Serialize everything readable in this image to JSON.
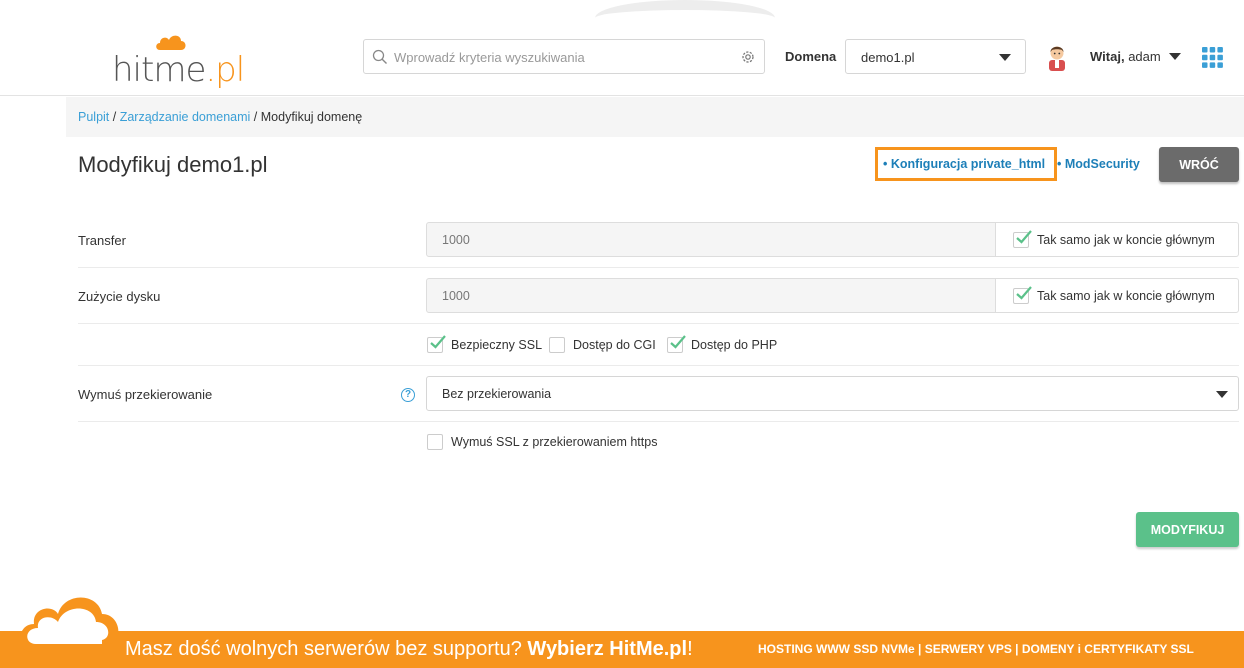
{
  "header": {
    "logo_text": "hitme",
    "logo_suffix": ".pl",
    "search_placeholder": "Wprowadź kryteria wyszukiwania",
    "domain_label": "Domena",
    "domain_value": "demo1.pl",
    "greeting_bold": "Witaj,",
    "greeting_user": "adam"
  },
  "breadcrumb": {
    "items": [
      "Pulpit",
      "Zarządzanie domenami"
    ],
    "separator": " / ",
    "current": "Modyfikuj domenę"
  },
  "page": {
    "title": "Modyfikuj demo1.pl",
    "link_private_html": "Konfiguracja private_html",
    "link_modsecurity": "ModSecurity",
    "back_label": "WRÓĆ",
    "bullet": "•"
  },
  "form": {
    "transfer": {
      "label": "Transfer",
      "value": "1000",
      "inherit_label": "Tak samo jak w koncie głównym",
      "inherit_checked": true
    },
    "disk": {
      "label": "Zużycie dysku",
      "value": "1000",
      "inherit_label": "Tak samo jak w koncie głównym",
      "inherit_checked": true
    },
    "options": [
      {
        "label": "Bezpieczny SSL",
        "checked": true
      },
      {
        "label": "Dostęp do CGI",
        "checked": false
      },
      {
        "label": "Dostęp do PHP",
        "checked": true
      }
    ],
    "redirect": {
      "label": "Wymuś przekierowanie",
      "value": "Bez przekierowania",
      "help": "?"
    },
    "force_ssl": {
      "label": "Wymuś SSL z przekierowaniem https",
      "checked": false
    },
    "submit_label": "MODYFIKUJ"
  },
  "footer": {
    "text": "Masz dość wolnych serwerów bez supportu?",
    "cta": "Wybierz HitMe.pl",
    "exclaim": "!",
    "links": "HOSTING WWW SSD NVMe | SERWERY VPS | DOMENY i CERTYFIKATY SSL"
  },
  "colors": {
    "accent_orange": "#f7941d",
    "link_blue": "#1d7fb8",
    "check_green": "#5bc18a",
    "back_gray": "#6b6b6b"
  }
}
